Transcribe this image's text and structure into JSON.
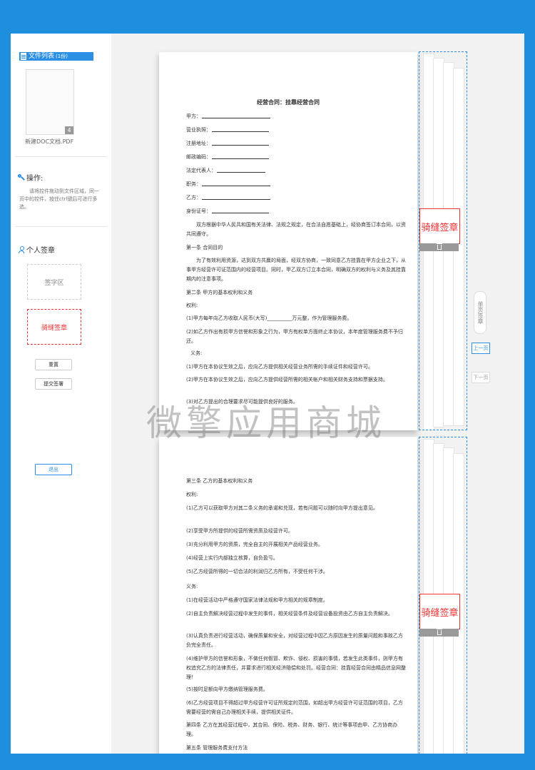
{
  "sidebar": {
    "file_list_label": "文件列表",
    "file_count": "(1份)",
    "file_pages": "4",
    "file_name": "新建DOC文档.PDF",
    "operations_title": "操作:",
    "operations_desc": "请将控件拖动到文件区域，同一页中的控件，按住ctrl键后可进行多选。",
    "signature_title": "个人签章",
    "sign_zone_label": "签字区",
    "seam_seal_label": "骑缝签章",
    "reset_label": "重置",
    "submit_label": "提交签署",
    "exit_label": "退出"
  },
  "viewer": {
    "seal_label": "骑缝签章",
    "single_page_sign": "单页签章",
    "prev_label": "上一页",
    "next_label": "下一页"
  },
  "page1": {
    "title": "经营合同：挂靠经营合同",
    "fields": [
      "甲方：",
      "营业执照：",
      "注册地址：",
      "邮政编码：",
      "法定代表人：",
      "职务：",
      "乙方：",
      "身份证号："
    ],
    "intro": "双方根据中华人民共和国有关法律、法规之规定，在合法自愿基础上，经协商签订本合同，以资共同遵守。",
    "art1_title": "第一条  合同目的",
    "art1_body": "为了有效利用资源，达到双方共赢的局面，经双方协商，一致同意乙方挂靠在甲方企业之下，从事甲方经营许可证范围内的经营项目。同时，甲乙双方订立本合同，明确双方的权利与义务及其挂靠期内的注意事项。",
    "art2_title": "第二条  甲方的基本权利和义务",
    "rights": "权利:",
    "r1": "(1)甲方每年向乙方收取人民币(大写)__________万元整，作为管理服务费。",
    "r2": "(2)如乙方作出有损甲方信誉和形象之行为，甲方有权单方面终止本协议，本年度管理服务费不予归还。",
    "duties": "义务:",
    "d1": "(1)甲方在本协议生效之后，应向乙方提供相关经营业务所需的手续证件和经营许可。",
    "d2": "(2)甲方在本协议生效之后，应向乙方提供经营所需的相关帐户和相关财务支持和票据支持。",
    "d3": "(3)对乙方提出的合理要求尽可能提供良好的服务。"
  },
  "page2": {
    "art3_title": "第三条  乙方的基本权利和义务",
    "rights": "权利:",
    "r1": "(1)乙方可以获取甲方对其二条义务的承诺和兑现，若有问题可以随时向甲方提出意见。",
    "r2": "(2)享受甲方所提供的经营所需资质及经营许可。",
    "r3": "(3)充分利用甲方的资质，完全自主的开展相关产品经营业务。",
    "r4": "(4)经营上实行内部独立核算，自负盈亏。",
    "r5": "(5)乙方经营所得的一切合法的利润归乙方所有，不受任何干涉。",
    "duties": "义务:",
    "d1": "(1)在经营活动中严格遵守国家法律法规和甲方相关的规章制度。",
    "d2": "(2)自主负责解决经营过程中发生的事件，相关经营条件及经营设备投资由乙方自主负责解决。",
    "d3": "(3)认真负责进行经营活动，确保质量和安全，对经营过程中因乙方原因发生的质量问题和事故乙方负完全责任。",
    "d4": "(4)维护甲方的信誉和形象，不做任何假冒、欺诈、侵权、损害的事情，若发生此类事件，则甲方有权追究乙方的法律责任，并要求进行相关经济赔偿和处罚。经营合同：挂靠经营合同由精品信息网整理！",
    "d5": "(5)按时足额向甲方缴纳管理服务费。",
    "d6": "(6)乙方经营项目不得超过甲方经营许可证所规定的范围，如超出甲方经营许可证范围的项目，乙方需要经营的需自己办理相关手续，提供相关证件。",
    "art4": "第四条  乙方在其经营过程中，其合同、保险、税务、财务、银行、统计等事项由甲、乙方协商办理。",
    "art5_title": "第五条  管理服务费支付方法"
  },
  "watermark": "微擎应用商城"
}
